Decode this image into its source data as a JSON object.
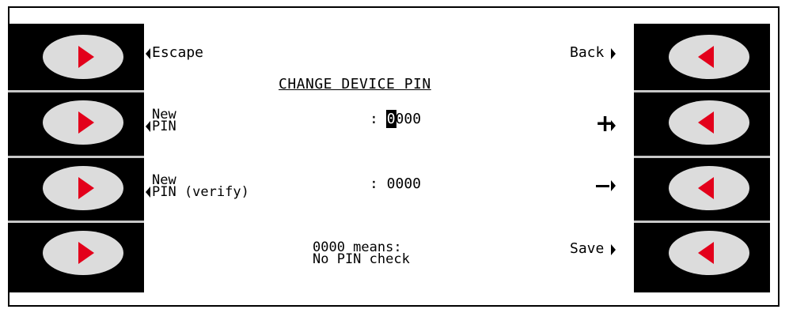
{
  "colors": {
    "arrow": "#e3001b",
    "key": "#dcdcdc",
    "panel": "#000000",
    "separator": "#c8c8c8"
  },
  "screen": {
    "escape": "Escape",
    "back": "Back",
    "title": "CHANGE DEVICE PIN",
    "new_pin_label_1": "New",
    "new_pin_label_2": "PIN",
    "new_pin_sep": ": ",
    "new_pin_cursor": "0",
    "new_pin_rest": "000",
    "plus": "+",
    "verify_label_1": "New",
    "verify_label_2": "PIN (verify)",
    "verify_value": ": 0000",
    "minus": "−",
    "hint_1": "0000 means:",
    "hint_2": "No PIN check",
    "save": "Save"
  },
  "icons": {
    "left_keys": "arrow-right-icon",
    "right_keys": "arrow-left-icon"
  }
}
